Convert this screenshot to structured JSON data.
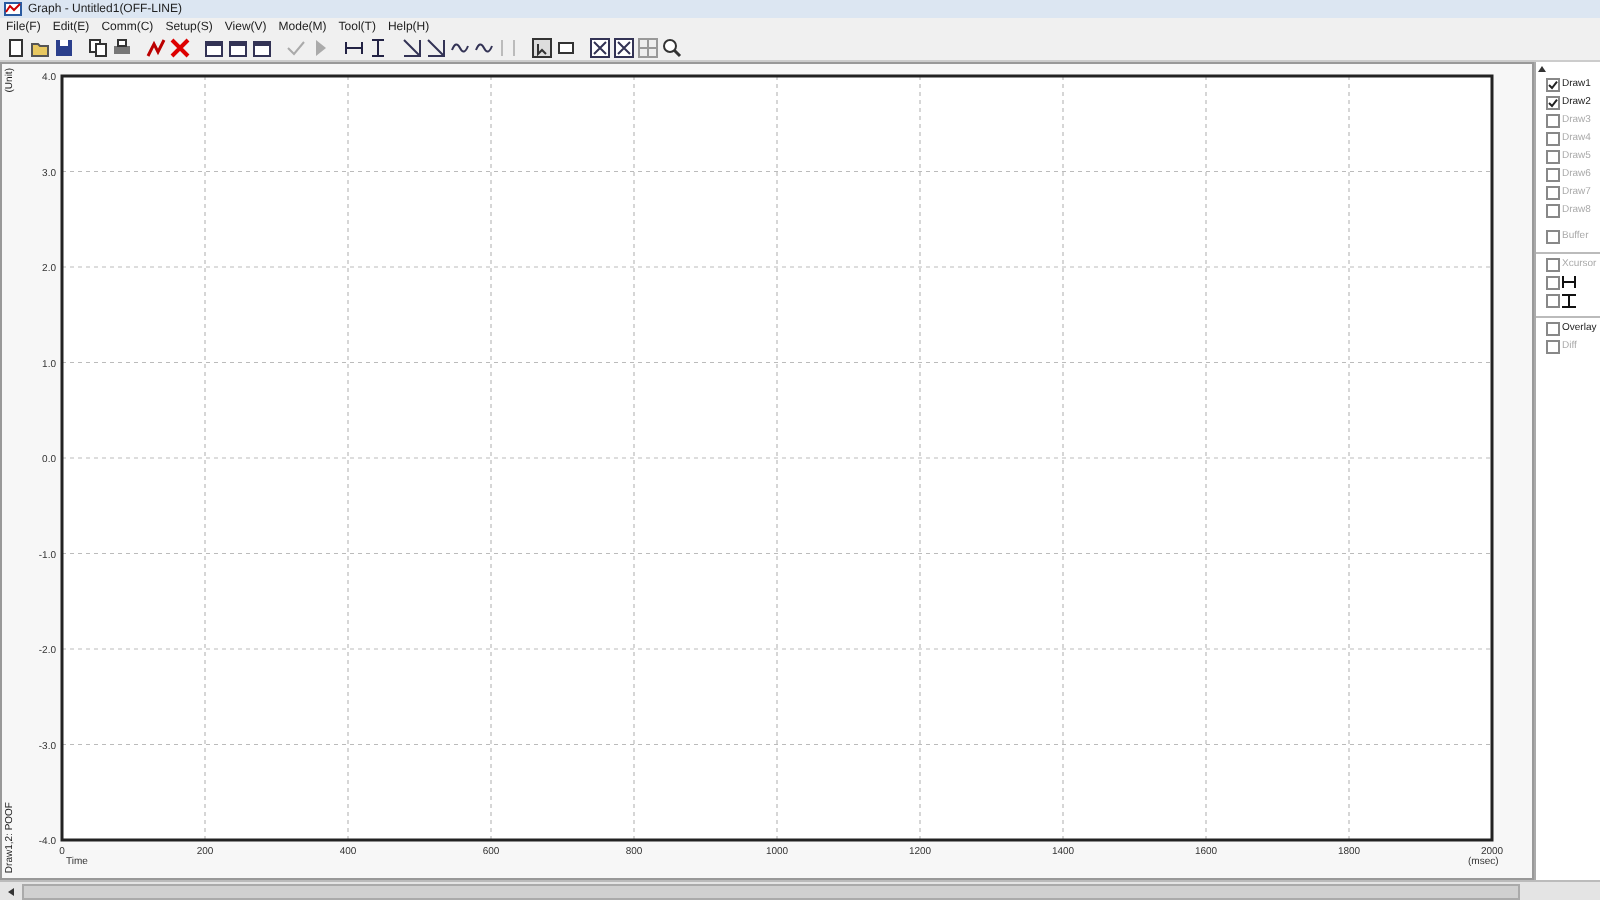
{
  "window": {
    "title": "Graph - Untitled1(OFF-LINE)"
  },
  "menu": [
    "File(F)",
    "Edit(E)",
    "Comm(C)",
    "Setup(S)",
    "View(V)",
    "Mode(M)",
    "Tool(T)",
    "Help(H)"
  ],
  "graph": {
    "y_unit": "(Unit)",
    "legend": "Draw1,2: POOF",
    "x_name": "Time",
    "x_unit": "(msec)",
    "chart_data": {
      "type": "line",
      "grid": true,
      "xlim": [
        0,
        2000
      ],
      "ylim": [
        -4,
        4
      ],
      "xticks": [
        0,
        200,
        400,
        600,
        800,
        1000,
        1200,
        1400,
        1600,
        1800,
        2000
      ],
      "yticks": [
        {
          "value": 4,
          "label": "4.0"
        },
        {
          "value": 3,
          "label": "3.0"
        },
        {
          "value": 2,
          "label": "2.0"
        },
        {
          "value": 1,
          "label": "1.0"
        },
        {
          "value": 0,
          "label": "0.0"
        },
        {
          "value": -1,
          "label": "-1.0"
        },
        {
          "value": -2,
          "label": "-2.0"
        },
        {
          "value": -3,
          "label": "-3.0"
        },
        {
          "value": -4,
          "label": "-4.0"
        }
      ]
    }
  },
  "panel": {
    "draws": [
      {
        "label": "Draw1",
        "checked": true,
        "disabled": false
      },
      {
        "label": "Draw2",
        "checked": true,
        "disabled": false
      },
      {
        "label": "Draw3",
        "checked": false,
        "disabled": true
      },
      {
        "label": "Draw4",
        "checked": false,
        "disabled": true
      },
      {
        "label": "Draw5",
        "checked": false,
        "disabled": true
      },
      {
        "label": "Draw6",
        "checked": false,
        "disabled": true
      },
      {
        "label": "Draw7",
        "checked": false,
        "disabled": true
      },
      {
        "label": "Draw8",
        "checked": false,
        "disabled": true
      }
    ],
    "buffer": {
      "label": "Buffer",
      "checked": false,
      "disabled": true
    },
    "cursors": [
      {
        "kind": "text",
        "label": "Xcursor",
        "checked": false,
        "disabled": true
      },
      {
        "kind": "hcursor",
        "checked": false,
        "disabled": false
      },
      {
        "kind": "vcursor",
        "checked": false,
        "disabled": false
      }
    ],
    "modes": [
      {
        "label": "Overlay",
        "checked": false,
        "disabled": false
      },
      {
        "label": "Diff",
        "checked": false,
        "disabled": true
      }
    ]
  }
}
